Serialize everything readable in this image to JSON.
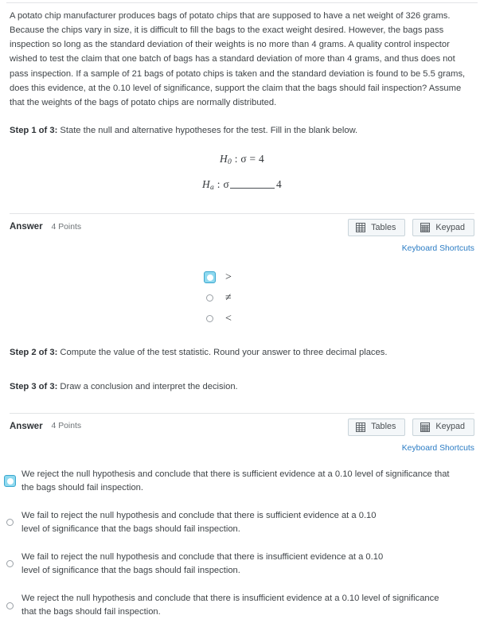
{
  "problem": {
    "text": "A potato chip manufacturer produces bags of potato chips that are supposed to have a net weight of 326 grams. Because the chips vary in size, it is difficult to fill the bags to the exact weight desired. However, the bags pass inspection so long as the standard deviation of their weights is no more than 4 grams. A quality control inspector wished to test the claim that one batch of bags has a standard deviation of more than 4 grams, and thus does not pass inspection. If a sample of 21 bags of potato chips is taken and the standard deviation is found to be 5.5 grams, does this evidence, at the 0.10 level of significance, support the claim that the bags should fail inspection? Assume that the weights of the bags of potato chips are normally distributed."
  },
  "steps": {
    "step1": {
      "label": "Step 1 of 3:",
      "text": " State the null and alternative hypotheses for the test. Fill in the blank below."
    },
    "step2": {
      "label": "Step 2 of 3:",
      "text": " Compute the value of the test statistic. Round your answer to three decimal places."
    },
    "step3": {
      "label": "Step 3 of 3:",
      "text": " Draw a conclusion and interpret the decision."
    }
  },
  "hypotheses": {
    "null_H": "H",
    "null_sub": "0",
    "null_body": " : σ = 4",
    "alt_H": "H",
    "alt_sub": "a",
    "alt_prefix": " : σ",
    "alt_value": "4"
  },
  "answer1": {
    "title": "Answer",
    "points": "4 Points",
    "tables_label": "Tables",
    "keypad_label": "Keypad",
    "shortcuts_label": "Keyboard Shortcuts",
    "options": [
      {
        "symbol": ">",
        "selected": true
      },
      {
        "symbol": "≠",
        "selected": false
      },
      {
        "symbol": "<",
        "selected": false
      }
    ]
  },
  "answer2": {
    "title": "Answer",
    "points": "4 Points",
    "tables_label": "Tables",
    "keypad_label": "Keypad",
    "shortcuts_label": "Keyboard Shortcuts",
    "options": [
      {
        "text": "We reject the null hypothesis and conclude that there is sufficient evidence at a 0.10 level of significance that the bags should fail inspection.",
        "selected": true
      },
      {
        "text": "We fail to reject the null hypothesis and conclude that there is sufficient evidence at a 0.10 level of significance that the bags should fail inspection.",
        "selected": false
      },
      {
        "text": "We fail to reject the null hypothesis and conclude that there is insufficient evidence at a 0.10 level of significance that the bags should fail inspection.",
        "selected": false
      },
      {
        "text": "We reject the null hypothesis and conclude that there is insufficient evidence at a 0.10 level of significance that the bags should fail inspection.",
        "selected": false
      }
    ]
  },
  "colors": {
    "link": "#2b7cc4",
    "focus_ring": "#8fd9ef",
    "divider": "#e2e4e6",
    "button_bg": "#f4f7f9"
  }
}
